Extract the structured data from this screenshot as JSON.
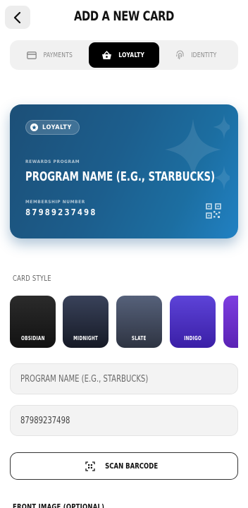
{
  "header": {
    "title": "ADD A NEW CARD"
  },
  "tabs": [
    {
      "label": "PAYMENTS",
      "icon": "credit-card-icon",
      "active": false
    },
    {
      "label": "LOYALTY",
      "icon": "shopping-basket-icon",
      "active": true
    },
    {
      "label": "IDENTITY",
      "icon": "fingerprint-icon",
      "active": false
    }
  ],
  "card_preview": {
    "badge": "LOYALTY",
    "program_caption": "REWARDS PROGRAM",
    "program_name": "PROGRAM NAME (E.G., STARBUCKS)",
    "number_caption": "MEMBERSHIP NUMBER",
    "number": "87989237498",
    "accent": "#1c5e8d"
  },
  "card_style": {
    "label": "CARD STYLE",
    "options": [
      {
        "label": "OBSIDIAN",
        "color": "#1c1c1c"
      },
      {
        "label": "MIDNIGHT",
        "color": "#24293a"
      },
      {
        "label": "SLATE",
        "color": "#3f4757"
      },
      {
        "label": "INDIGO",
        "color": "#4b2fc0"
      },
      {
        "label": "",
        "color": "#6a2cc4"
      }
    ]
  },
  "form": {
    "program_placeholder": "PROGRAM NAME (E.G., STARBUCKS)",
    "number_value": "87989237498",
    "scan_label": "SCAN BARCODE",
    "front_image_label": "FRONT IMAGE (OPTIONAL)"
  }
}
